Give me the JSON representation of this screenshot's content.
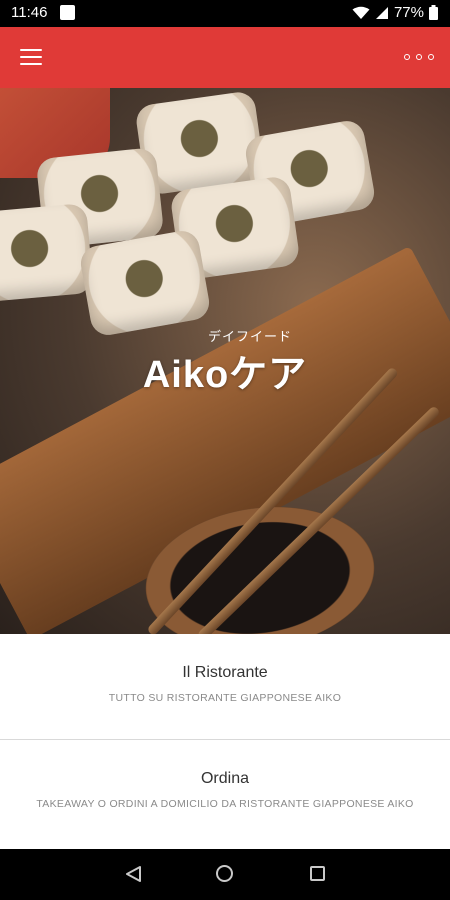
{
  "status_bar": {
    "time": "11:46",
    "battery": "77%",
    "icons": [
      "notification-square-icon",
      "wifi-icon",
      "signal-icon",
      "battery-icon"
    ]
  },
  "app_bar": {
    "color": "#e03a37",
    "left_icon": "menu-icon",
    "right_icon": "more-options-icon"
  },
  "hero": {
    "logo_subtitle": "デイフイード",
    "logo_title": "Aikoケア"
  },
  "sections": [
    {
      "title": "Il Ristorante",
      "subtitle": "TUTTO SU RISTORANTE GIAPPONESE AIKO"
    },
    {
      "title": "Ordina",
      "subtitle": "TAKEAWAY O ORDINI A DOMICILIO DA RISTORANTE GIAPPONESE AIKO"
    }
  ],
  "nav_bar": {
    "icons": [
      "back-icon",
      "home-icon",
      "recents-icon"
    ]
  }
}
